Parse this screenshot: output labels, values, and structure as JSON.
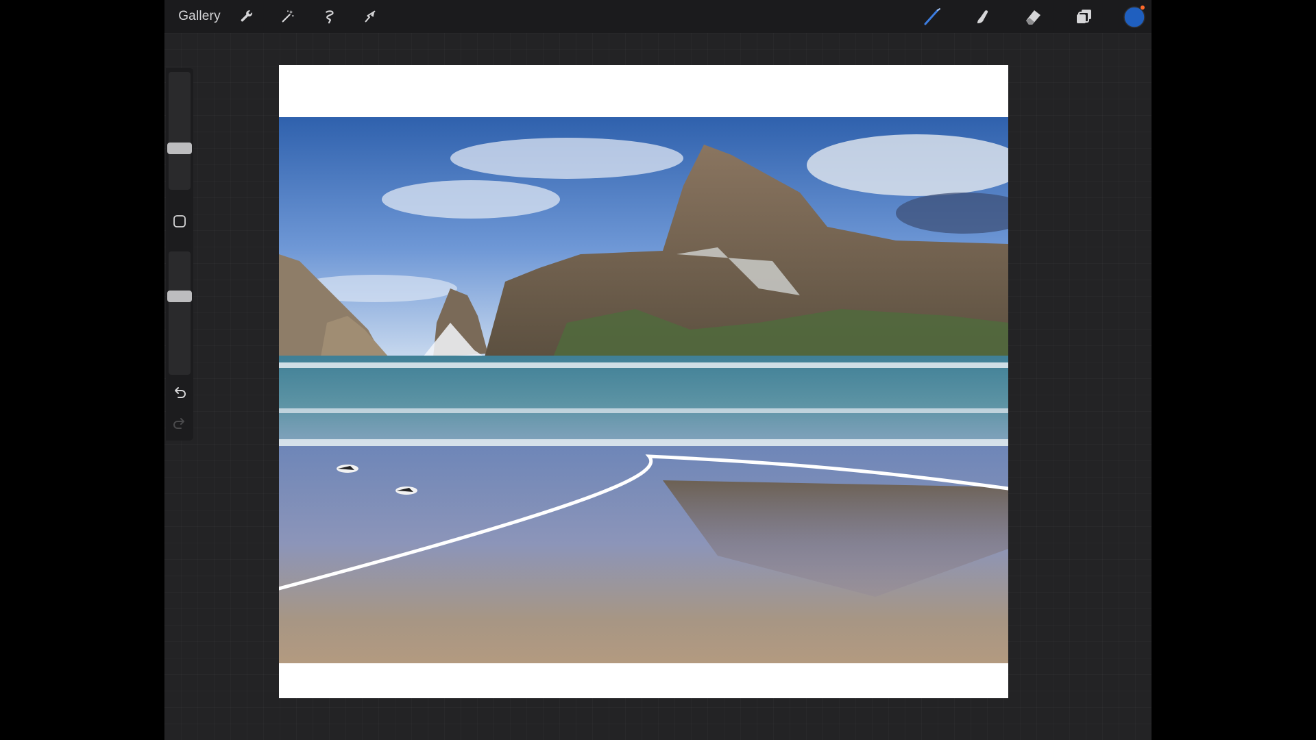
{
  "topbar": {
    "gallery_label": "Gallery",
    "left_tools": [
      "wrench-icon",
      "magic-wand-icon",
      "selection-icon",
      "transform-arrow-icon"
    ],
    "right_tools": [
      "brush-icon",
      "smudge-icon",
      "eraser-icon",
      "layers-icon",
      "color-swatch"
    ],
    "active_color": "#1f5fbf",
    "accent_dot_color": "#ff6a2b"
  },
  "sidebar": {
    "controls": [
      "brush-size-slider",
      "modify-button",
      "opacity-slider",
      "undo-icon",
      "redo-icon"
    ]
  },
  "canvas": {
    "subject": "beach-seascape-photo",
    "background": "#ffffff"
  }
}
